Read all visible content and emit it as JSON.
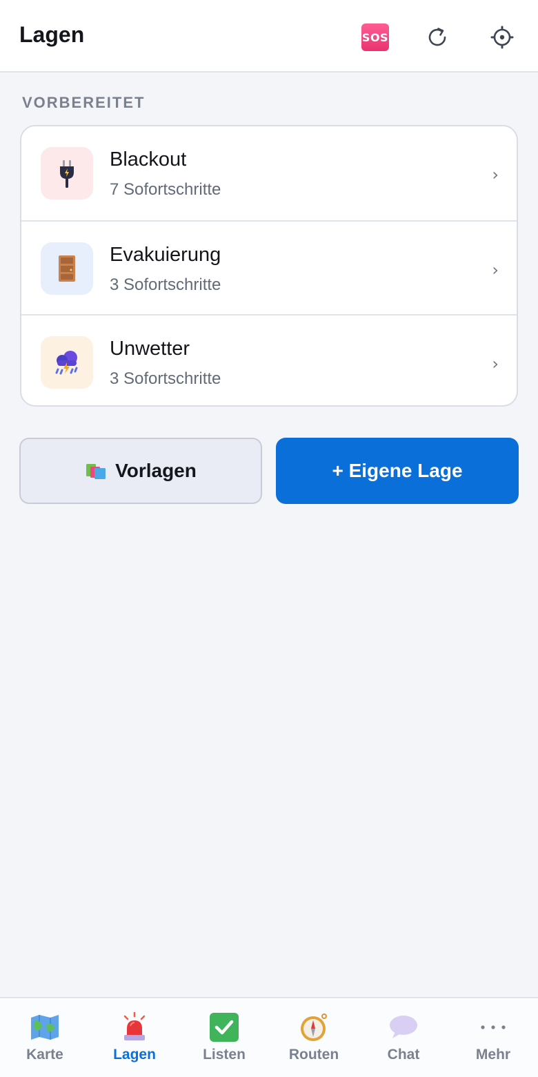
{
  "header": {
    "title": "Lagen",
    "sos_label": "SOS",
    "icons": [
      "sos-icon",
      "refresh-icon",
      "settings-icon"
    ]
  },
  "section": {
    "label": "VORBEREITET"
  },
  "scenarios": [
    {
      "title": "Blackout",
      "subtitle": "7 Sofortschritte",
      "icon": "plug-icon",
      "icon_bg": "#fde8ea"
    },
    {
      "title": "Evakuierung",
      "subtitle": "3 Sofortschritte",
      "icon": "door-icon",
      "icon_bg": "#e6effb"
    },
    {
      "title": "Unwetter",
      "subtitle": "3 Sofortschritte",
      "icon": "storm-icon",
      "icon_bg": "#fdf1e2"
    }
  ],
  "actions": {
    "templates_label": "Vorlagen",
    "own_label": "+ Eigene Lage"
  },
  "nav": {
    "items": [
      {
        "label": "Karte",
        "icon": "map-icon",
        "active": false
      },
      {
        "label": "Lagen",
        "icon": "siren-icon",
        "active": true
      },
      {
        "label": "Listen",
        "icon": "checklist-icon",
        "active": false
      },
      {
        "label": "Routen",
        "icon": "compass-icon",
        "active": false
      },
      {
        "label": "Chat",
        "icon": "chat-bubble-icon",
        "active": false
      },
      {
        "label": "Mehr",
        "icon": "more-icon",
        "active": false
      }
    ]
  },
  "colors": {
    "accent": "#0b6fd9",
    "sos": "#e8336f",
    "background": "#f3f5f9"
  }
}
